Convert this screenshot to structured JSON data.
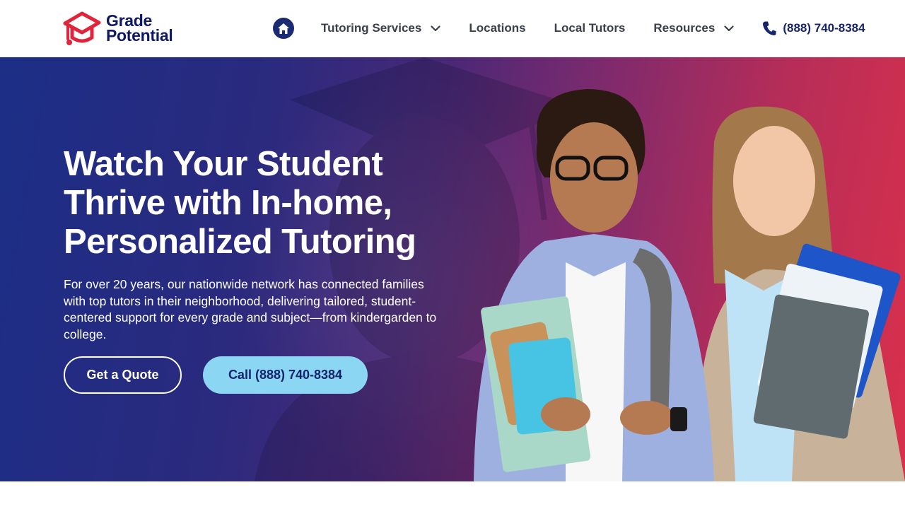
{
  "brand": {
    "name_line1": "Grade",
    "name_line2": "Potential",
    "color_primary": "#0d1a63",
    "color_accent": "#e0243b"
  },
  "nav": {
    "home_icon": "home-icon",
    "items": [
      {
        "label": "Tutoring Services",
        "has_dropdown": true
      },
      {
        "label": "Locations",
        "has_dropdown": false
      },
      {
        "label": "Local Tutors",
        "has_dropdown": false
      },
      {
        "label": "Resources",
        "has_dropdown": true
      }
    ],
    "phone": "(888) 740-8384",
    "phone_icon": "phone-icon"
  },
  "hero": {
    "headline_line1": "Watch Your Student",
    "headline_line2": "Thrive with In-home,",
    "headline_line3": "Personalized Tutoring",
    "subtext": "For over 20 years, our nationwide network has connected families with top tutors in their neighborhood, delivering tailored, student-centered support for every grade and subject—from kindergarden to college.",
    "primary_button": "Get a Quote",
    "secondary_button": "Call (888) 740-8384",
    "colors": {
      "gradient_start": "#1c2e86",
      "gradient_end": "#d9304b",
      "call_button": "#8ad6f3"
    }
  }
}
